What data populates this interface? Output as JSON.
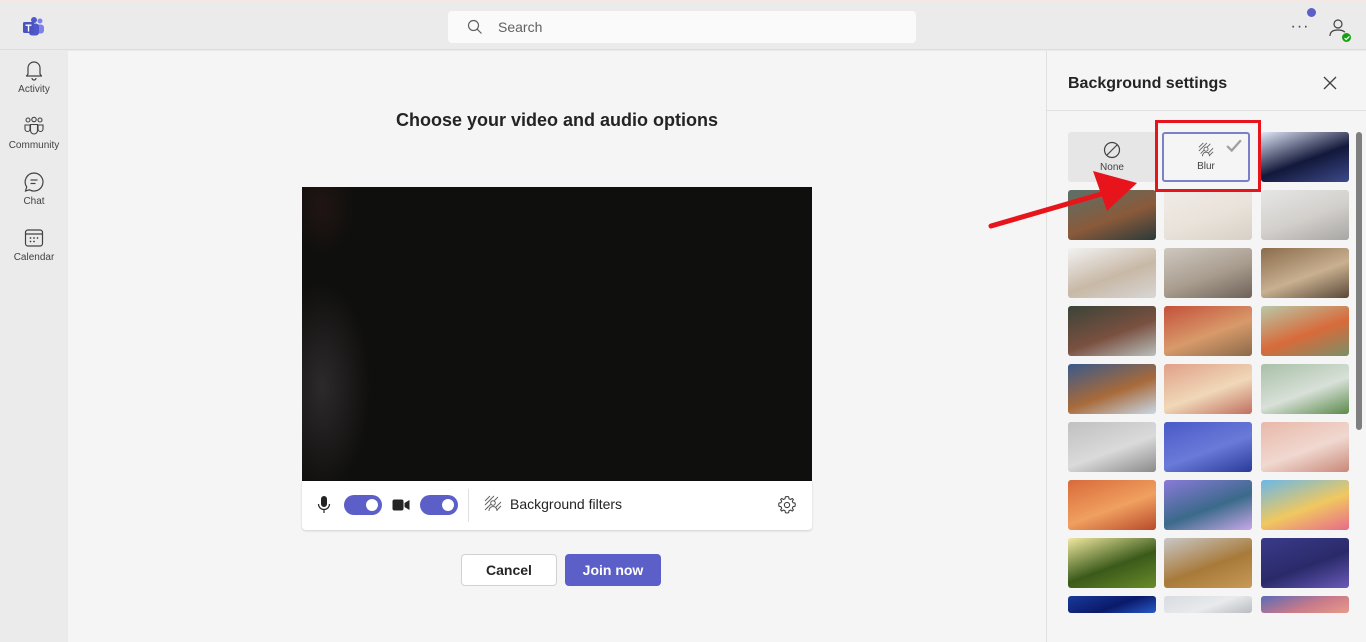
{
  "app": {
    "name": "Microsoft Teams"
  },
  "titlebar": {
    "search_placeholder": "Search",
    "more_label": "···",
    "icons": {
      "logo": "teams-logo-icon",
      "search": "search-icon",
      "more": "more-options-icon",
      "avatar": "person-icon",
      "presence": "presence-available-icon"
    }
  },
  "rail": {
    "items": [
      {
        "label": "Activity",
        "icon": "bell-icon"
      },
      {
        "label": "Community",
        "icon": "people-community-icon"
      },
      {
        "label": "Chat",
        "icon": "chat-bubble-icon"
      },
      {
        "label": "Calendar",
        "icon": "calendar-icon"
      }
    ]
  },
  "prejoin": {
    "heading": "Choose your video and audio options",
    "mic_on": true,
    "camera_on": true,
    "background_filters_label": "Background filters",
    "cancel_label": "Cancel",
    "join_label": "Join now"
  },
  "background_panel": {
    "title": "Background settings",
    "selected": "Blur",
    "tiles": [
      {
        "label": "None",
        "kind": "none"
      },
      {
        "label": "Blur",
        "kind": "blur",
        "selected": true
      },
      {
        "label": "",
        "kind": "image",
        "description": "space warp with vehicle",
        "colors": [
          "#e0e6f6",
          "#3d4a8c",
          "#12183a"
        ]
      },
      {
        "label": "",
        "kind": "image",
        "description": "desert landscape at dusk with ruins",
        "colors": [
          "#5a7068",
          "#2b3a3a",
          "#8a5a3a"
        ]
      },
      {
        "label": "",
        "kind": "image",
        "description": "minimal white room",
        "colors": [
          "#f0ece6",
          "#d8d0c6",
          "#e9e2da"
        ]
      },
      {
        "label": "",
        "kind": "image",
        "description": "bright living room with windows",
        "colors": [
          "#e6e6e6",
          "#a8a6a2",
          "#d2cfcb"
        ]
      },
      {
        "label": "",
        "kind": "image",
        "description": "white room with round arches",
        "colors": [
          "#f2f2f2",
          "#d8d6d4",
          "#c8b8a6"
        ]
      },
      {
        "label": "",
        "kind": "image",
        "description": "neutral lounge with plants",
        "colors": [
          "#cfc8c0",
          "#6e6258",
          "#a89c8e"
        ]
      },
      {
        "label": "",
        "kind": "image",
        "description": "warm dining room",
        "colors": [
          "#8a6c4c",
          "#5a4838",
          "#c8b090"
        ]
      },
      {
        "label": "",
        "kind": "image",
        "description": "glass conservatory with plants",
        "colors": [
          "#3a4438",
          "#b8c0bc",
          "#7a5040"
        ]
      },
      {
        "label": "",
        "kind": "image",
        "description": "terracotta room with pergola",
        "colors": [
          "#c4503a",
          "#8a6a4a",
          "#d89a6a"
        ]
      },
      {
        "label": "",
        "kind": "image",
        "description": "green arched corridor with flowers",
        "colors": [
          "#b8c8a8",
          "#7a9068",
          "#d86a3a"
        ]
      },
      {
        "label": "",
        "kind": "image",
        "description": "curved blue architecture",
        "colors": [
          "#3a5a8a",
          "#c8d8e8",
          "#a86a3a"
        ]
      },
      {
        "label": "",
        "kind": "image",
        "description": "pink arch with desert view",
        "colors": [
          "#e0a088",
          "#c07060",
          "#f0d8b8"
        ]
      },
      {
        "label": "",
        "kind": "image",
        "description": "round window to garden",
        "colors": [
          "#a8c0a8",
          "#5a8a4a",
          "#d8e0d8"
        ]
      },
      {
        "label": "",
        "kind": "image",
        "description": "grey wall with arched door",
        "colors": [
          "#c0c0c0",
          "#8a8a8a",
          "#dadada"
        ]
      },
      {
        "label": "",
        "kind": "image",
        "description": "blue arched doorway",
        "colors": [
          "#4a5ac8",
          "#2a3a98",
          "#6a7ad8"
        ]
      },
      {
        "label": "",
        "kind": "image",
        "description": "pink arches with blossoms",
        "colors": [
          "#e8b8a8",
          "#c88878",
          "#f0d8d0"
        ]
      },
      {
        "label": "",
        "kind": "image",
        "description": "autumn forest fantasy",
        "colors": [
          "#d86a3a",
          "#b84a2a",
          "#f0a060"
        ]
      },
      {
        "label": "",
        "kind": "image",
        "description": "purple underwater flowers",
        "colors": [
          "#8a7ad8",
          "#c8a8e8",
          "#3a6a8a"
        ]
      },
      {
        "label": "",
        "kind": "image",
        "description": "colorful coral reef",
        "colors": [
          "#6ab8e8",
          "#e86a8a",
          "#f0c860"
        ]
      },
      {
        "label": "",
        "kind": "image",
        "description": "sunlit green forest",
        "colors": [
          "#f0e8a0",
          "#6a8a2a",
          "#3a5a1a"
        ]
      },
      {
        "label": "",
        "kind": "image",
        "description": "golden desert hills",
        "colors": [
          "#c8c8c8",
          "#c89a5a",
          "#a87a3a"
        ]
      },
      {
        "label": "",
        "kind": "image",
        "description": "purple mountains at night",
        "colors": [
          "#3a3a8a",
          "#6a5ab8",
          "#2a2a6a"
        ]
      },
      {
        "label": "",
        "kind": "image",
        "description": "blue starry sky",
        "colors": [
          "#1a3a9a",
          "#2a5ac8",
          "#0a1a6a"
        ]
      },
      {
        "label": "",
        "kind": "image",
        "description": "white clouds",
        "colors": [
          "#d8dce0",
          "#b8bcc0",
          "#e8eaec"
        ]
      },
      {
        "label": "",
        "kind": "image",
        "description": "pink sunset clouds",
        "colors": [
          "#5a6ab8",
          "#e89a8a",
          "#c87a8a"
        ]
      }
    ]
  },
  "annotation": {
    "color": "#e8141c",
    "target": "Blur"
  },
  "colors": {
    "accent": "#5b5fc7",
    "presence": "#13a10e",
    "annotation_red": "#e8141c"
  }
}
